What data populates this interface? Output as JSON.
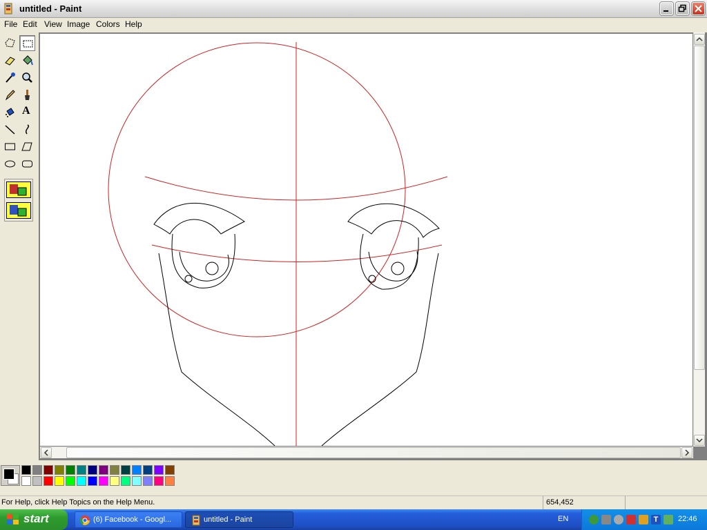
{
  "window": {
    "title": "untitled - Paint"
  },
  "menu": [
    "File",
    "Edit",
    "View",
    "Image",
    "Colors",
    "Help"
  ],
  "tools": [
    {
      "name": "free-form-select-tool",
      "icon": "free-select-icon"
    },
    {
      "name": "select-tool",
      "icon": "rect-select-icon",
      "selected": true
    },
    {
      "name": "eraser-tool",
      "icon": "eraser-icon"
    },
    {
      "name": "fill-tool",
      "icon": "paint-bucket-icon"
    },
    {
      "name": "pick-color-tool",
      "icon": "eyedropper-icon"
    },
    {
      "name": "magnifier-tool",
      "icon": "magnifier-icon"
    },
    {
      "name": "pencil-tool",
      "icon": "pencil-icon"
    },
    {
      "name": "brush-tool",
      "icon": "brush-icon"
    },
    {
      "name": "airbrush-tool",
      "icon": "airbrush-icon"
    },
    {
      "name": "text-tool",
      "icon": "text-icon",
      "glyph": "A"
    },
    {
      "name": "line-tool",
      "icon": "line-icon"
    },
    {
      "name": "curve-tool",
      "icon": "curve-icon"
    },
    {
      "name": "rectangle-tool",
      "icon": "rectangle-icon"
    },
    {
      "name": "polygon-tool",
      "icon": "polygon-icon"
    },
    {
      "name": "ellipse-tool",
      "icon": "ellipse-icon"
    },
    {
      "name": "rounded-rectangle-tool",
      "icon": "rounded-rect-icon"
    }
  ],
  "palette": {
    "foreground": "#000000",
    "background": "#ffffff",
    "row1": [
      "#000000",
      "#808080",
      "#800000",
      "#808000",
      "#008000",
      "#008080",
      "#000080",
      "#800080",
      "#808040",
      "#004040",
      "#0080ff",
      "#004080",
      "#8000ff",
      "#804000"
    ],
    "row2": [
      "#ffffff",
      "#c0c0c0",
      "#ff0000",
      "#ffff00",
      "#00ff00",
      "#00ffff",
      "#0000ff",
      "#ff00ff",
      "#ffff80",
      "#00ff80",
      "#80ffff",
      "#8080ff",
      "#ff0080",
      "#ff8040"
    ]
  },
  "status": {
    "help": "For Help, click Help Topics on the Help Menu.",
    "coords": "654,452"
  },
  "taskbar": {
    "start": "start",
    "tasks": [
      {
        "label": "(6) Facebook - Googl...",
        "icon": "chrome-icon",
        "active": false
      },
      {
        "label": "untitled - Paint",
        "icon": "paint-icon",
        "active": true
      }
    ],
    "lang": "EN",
    "clock": "22:46"
  }
}
